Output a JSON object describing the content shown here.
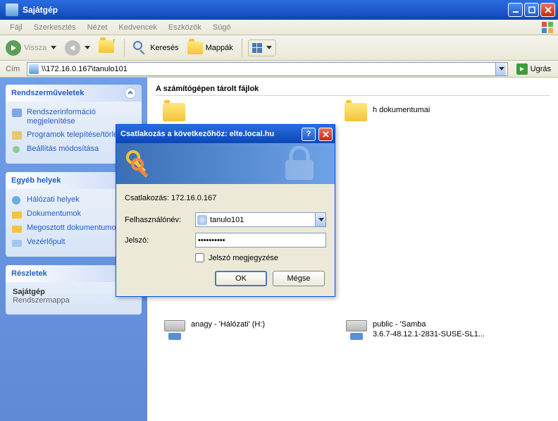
{
  "window": {
    "title": "Sajátgép"
  },
  "menu": {
    "file": "Fájl",
    "edit": "Szerkesztés",
    "view": "Nézet",
    "fav": "Kedvencek",
    "tools": "Eszközök",
    "help": "Súgó"
  },
  "toolbar": {
    "back": "Vissza",
    "search": "Keresés",
    "folders": "Mappák"
  },
  "addr": {
    "label": "Cím",
    "value": "\\\\172.16.0.167\\tanulo101",
    "go": "Ugrás"
  },
  "side": {
    "sys": {
      "title": "Rendszerműveletek",
      "i1": "Rendszerinformáció megjelenítése",
      "i2": "Programok telepítése/törlése",
      "i3": "Beállítás módosítása"
    },
    "other": {
      "title": "Egyéb helyek",
      "i1": "Hálózati helyek",
      "i2": "Dokumentumok",
      "i3": "Megosztott dokumentumok",
      "i4": "Vezérlőpult"
    },
    "details": {
      "title": "Részletek",
      "t1": "Sajátgép",
      "t2": "Rendszermappa"
    }
  },
  "main": {
    "section1": "A számítógépen tárolt fájlok",
    "docitem": "h dokumentumai",
    "drive1_a": "anagy - 'Hálózati' (H:)",
    "drive2_a": "public - 'Samba",
    "drive2_b": "3.6.7-48.12.1-2831-SUSE-SL1..."
  },
  "dialog": {
    "title": "Csatlakozás a következőhöz: elte.local.hu",
    "connect": "Csatlakozás: 172.16.0.167",
    "user_label": "Felhasználónév:",
    "user_value": "tanulo101",
    "pass_label": "Jelszó:",
    "pass_value": "••••••••••",
    "remember": "Jelszó megjegyzése",
    "ok": "OK",
    "cancel": "Mégse"
  }
}
